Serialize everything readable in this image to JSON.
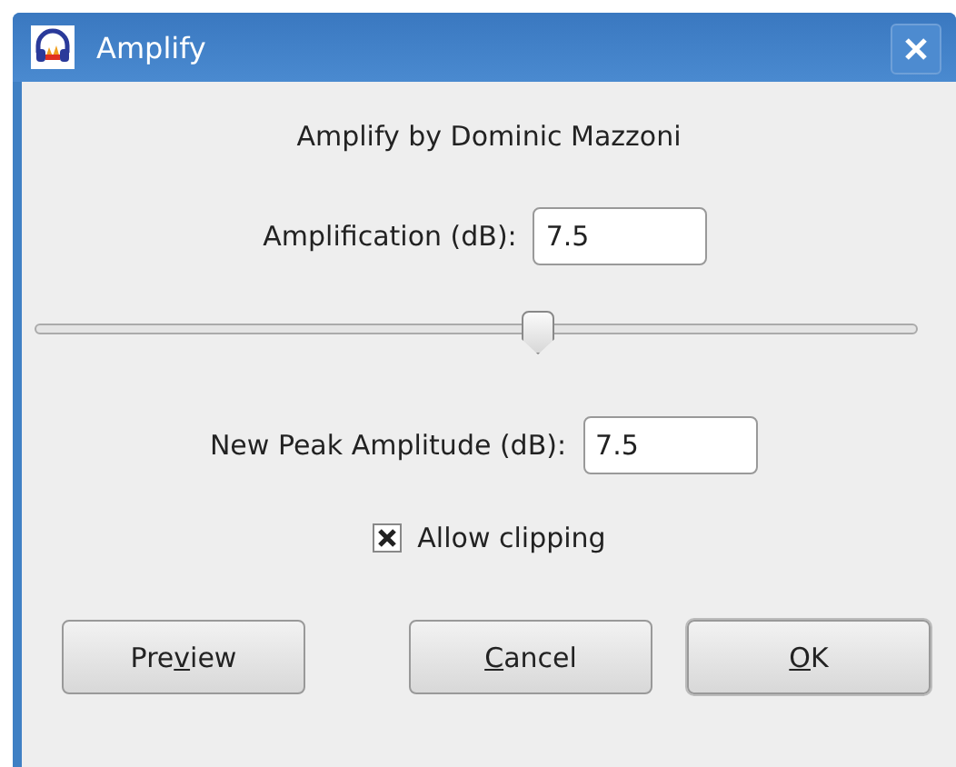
{
  "window": {
    "title": "Amplify"
  },
  "heading": "Amplify by Dominic Mazzoni",
  "amplification": {
    "label": "Amplification (dB):",
    "value": "7.5"
  },
  "slider": {
    "level": 0.57
  },
  "peak": {
    "label": "New Peak Amplitude (dB):",
    "value": "7.5"
  },
  "allow_clipping": {
    "label": "Allow clipping",
    "checked": true
  },
  "buttons": [
    {
      "text_before": "Pre",
      "mnemonic": "v",
      "text_after": "iew",
      "default": false
    },
    {
      "mnemonic": "C",
      "text_after": "ancel",
      "default": false
    },
    {
      "mnemonic": "O",
      "text_after": "K",
      "default": true
    }
  ]
}
